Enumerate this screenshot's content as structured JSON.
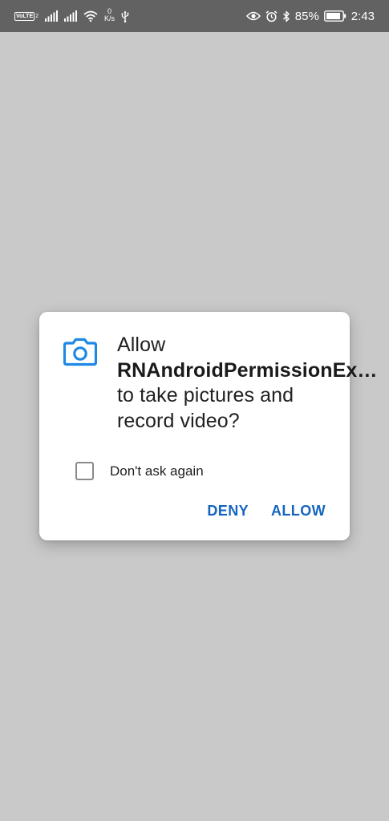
{
  "status_bar": {
    "volte": "VoLTE",
    "volte_sub": "2",
    "net_speed_value": "0",
    "net_speed_unit": "K/s",
    "battery_percent": "85%",
    "time": "2:43",
    "icons": [
      "volte-icon",
      "signal-icon",
      "signal-icon",
      "wifi-icon",
      "usb-icon",
      "eye-icon",
      "alarm-icon",
      "bluetooth-icon",
      "battery-icon"
    ]
  },
  "dialog": {
    "icon": "camera-icon",
    "message_prefix": "Allow ",
    "app_name": "RNAndroidPermissionEx…",
    "message_suffix": " to take pictures and record video?",
    "checkbox_label": "Don't ask again",
    "checkbox_checked": false,
    "deny_label": "DENY",
    "allow_label": "ALLOW"
  },
  "colors": {
    "accent": "#1565c0",
    "icon_blue": "#1e88e5",
    "scrim": "#c9c9c9",
    "status_bar": "#626262"
  }
}
